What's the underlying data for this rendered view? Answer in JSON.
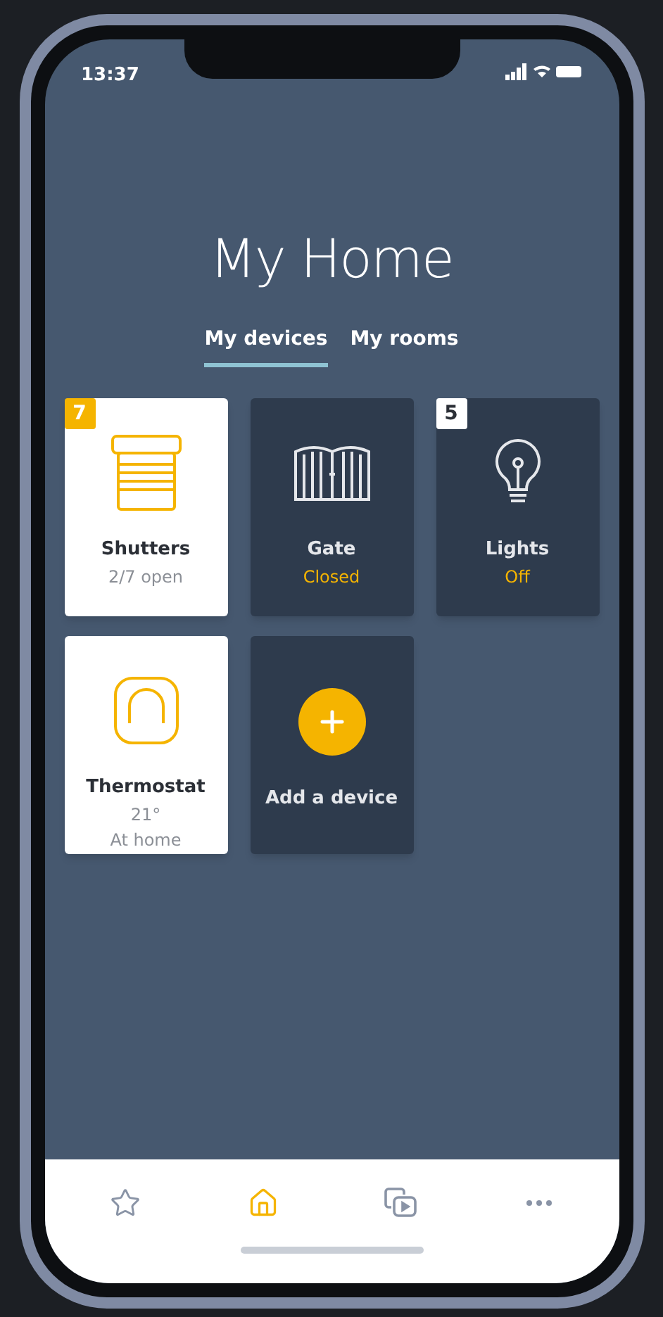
{
  "status_bar": {
    "time": "13:37"
  },
  "title": "My Home",
  "tabs": [
    {
      "label": "My devices",
      "selected": true
    },
    {
      "label": "My rooms",
      "selected": false
    }
  ],
  "devices": [
    {
      "kind": "shutters",
      "active": true,
      "badge": "7",
      "name": "Shutters",
      "status": "2/7 open",
      "status_highlighted": false
    },
    {
      "kind": "gate",
      "active": false,
      "name": "Gate",
      "status": "Closed",
      "status_highlighted": true
    },
    {
      "kind": "lights",
      "active": false,
      "badge": "5",
      "name": "Lights",
      "status": "Off",
      "status_highlighted": true
    },
    {
      "kind": "thermostat",
      "active": true,
      "name": "Thermostat",
      "status": "21°",
      "detail": "At home",
      "status_highlighted": false
    },
    {
      "kind": "add",
      "active": false,
      "name": "Add a device"
    }
  ],
  "nav": [
    {
      "kind": "favorites",
      "selected": false
    },
    {
      "kind": "home",
      "selected": true
    },
    {
      "kind": "media",
      "selected": false
    },
    {
      "kind": "more",
      "selected": false
    }
  ]
}
